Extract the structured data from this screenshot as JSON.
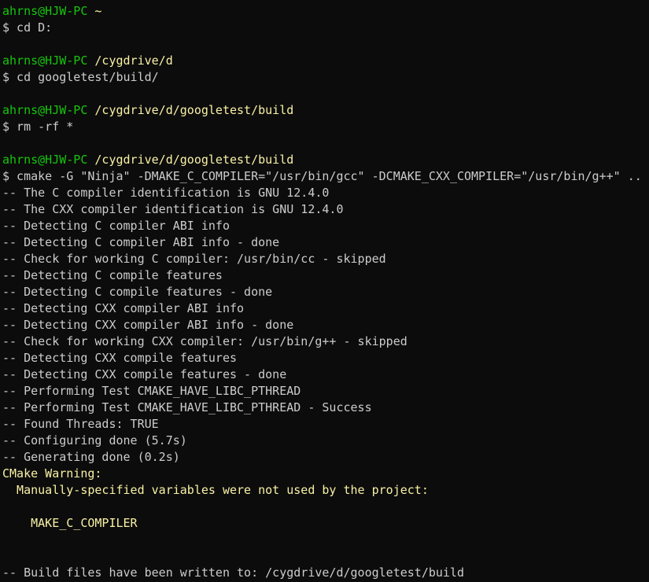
{
  "colors": {
    "background": "#0c0c0c",
    "text": "#cccccc",
    "prompt_user": "#16c60c",
    "prompt_path": "#f9f1a5",
    "warning": "#f9f1a5"
  },
  "blocks": [
    {
      "user": "ahrns@HJW-PC",
      "path": "~",
      "command": "$ cd D:"
    },
    {
      "user": "ahrns@HJW-PC",
      "path": "/cygdrive/d",
      "command": "$ cd googletest/build/"
    },
    {
      "user": "ahrns@HJW-PC",
      "path": "/cygdrive/d/googletest/build",
      "command": "$ rm -rf *"
    },
    {
      "user": "ahrns@HJW-PC",
      "path": "/cygdrive/d/googletest/build",
      "command": "$ cmake -G \"Ninja\" -DMAKE_C_COMPILER=\"/usr/bin/gcc\" -DCMAKE_CXX_COMPILER=\"/usr/bin/g++\" .."
    }
  ],
  "output": [
    "-- The C compiler identification is GNU 12.4.0",
    "-- The CXX compiler identification is GNU 12.4.0",
    "-- Detecting C compiler ABI info",
    "-- Detecting C compiler ABI info - done",
    "-- Check for working C compiler: /usr/bin/cc - skipped",
    "-- Detecting C compile features",
    "-- Detecting C compile features - done",
    "-- Detecting CXX compiler ABI info",
    "-- Detecting CXX compiler ABI info - done",
    "-- Check for working CXX compiler: /usr/bin/g++ - skipped",
    "-- Detecting CXX compile features",
    "-- Detecting CXX compile features - done",
    "-- Performing Test CMAKE_HAVE_LIBC_PTHREAD",
    "-- Performing Test CMAKE_HAVE_LIBC_PTHREAD - Success",
    "-- Found Threads: TRUE",
    "-- Configuring done (5.7s)",
    "-- Generating done (0.2s)"
  ],
  "warning": {
    "title": "CMake Warning:",
    "message": "  Manually-specified variables were not used by the project:",
    "variable": "    MAKE_C_COMPILER"
  },
  "final_line": "-- Build files have been written to: /cygdrive/d/googletest/build"
}
